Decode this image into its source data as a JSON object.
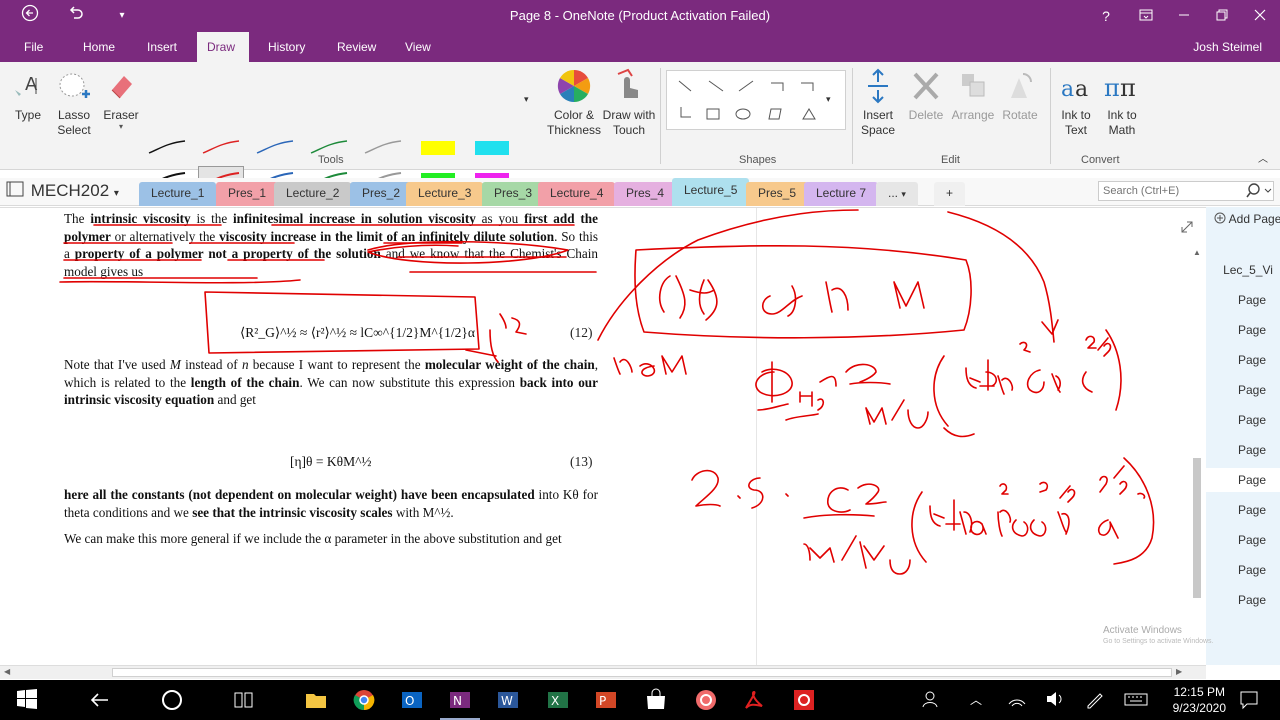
{
  "window": {
    "title": "Page 8 - OneNote (Product Activation Failed)",
    "help": "?",
    "user": "Josh Steimel"
  },
  "menu": {
    "tabs": [
      "File",
      "Home",
      "Insert",
      "Draw",
      "History",
      "Review",
      "View"
    ],
    "active": "Draw"
  },
  "ribbon": {
    "type": "Type",
    "lasso": "Lasso Select",
    "eraser": "Eraser",
    "color_thickness": "Color & Thickness",
    "draw_touch": "Draw with Touch",
    "insert_space": "Insert Space",
    "delete": "Delete",
    "arrange": "Arrange",
    "rotate": "Rotate",
    "ink_text": "Ink to Text",
    "ink_math": "Ink to Math",
    "groups": {
      "tools": "Tools",
      "shapes": "Shapes",
      "edit": "Edit",
      "convert": "Convert"
    }
  },
  "notebook": {
    "name": "MECH202"
  },
  "sections": [
    "Lecture_1",
    "Pres_1",
    "Lecture_2",
    "Pres_2",
    "Lecture_3",
    "Pres_3",
    "Lecture_4",
    "Pres_4",
    "Lecture_5",
    "Pres_5",
    "Lecture 7",
    "..."
  ],
  "active_section": "Lecture_5",
  "search": {
    "placeholder": "Search (Ctrl+E)"
  },
  "pages_panel": {
    "add_page": "Add Page",
    "items": [
      "Lec_5_Vi",
      "Page",
      "Page",
      "Page",
      "Page",
      "Page",
      "Page",
      "Page",
      "Page",
      "Page",
      "Page",
      "Page",
      "Page"
    ],
    "selected": 7
  },
  "document": {
    "para1_a": "The ",
    "para1_b": "intrinsic viscosity",
    "para1_c": " is the ",
    "para1_d": "infinitesimal increase in solution viscosity",
    "para1_e": " as you ",
    "para1_f": "first add the polymer",
    "para1_g": " or alternatively the ",
    "para1_h": "viscosity increase in the limit of an infinitely dilute solution",
    "para1_i": ". So this a ",
    "para1_j": "property of a polymer not a property of the solution",
    "para1_k": " and we know that the Chemist's Chain model gives us",
    "eq12": "⟨R²_G⟩^½ ≈ ⟨r²⟩^½ ≈ lC∞^{1/2}M^{1/2}α",
    "eq12_num": "(12)",
    "para2_a": "Note that I've used ",
    "para2_M": "M",
    "para2_b": " instead of ",
    "para2_n": "n",
    "para2_c": " because I want to represent the ",
    "para2_d": "molecular weight of the chain",
    "para2_e": ", which is related to the ",
    "para2_f": "length of the chain",
    "para2_g": ". We can now substitute this expression ",
    "para2_h": "back into our intrinsic viscosity equation",
    "para2_i": " and get",
    "eq13": "[η]θ = KθM^½",
    "eq13_num": "(13)",
    "para3_a": "here all the constants (not dependent on molecular weight) have been encapsulated",
    "para3_b": " into Kθ for theta conditions and we ",
    "para3_c": "see that the intrinsic viscosity scales",
    "para3_d": " with M^½.",
    "para4": "We can make this more general if we include the α parameter in the above substitution and get"
  },
  "watermark": {
    "line1": "Activate Windows",
    "line2": "Go to Settings to activate Windows."
  },
  "clock": {
    "time": "12:15 PM",
    "date": "9/23/2020"
  },
  "colors": {
    "accent": "#7b2a7e",
    "ink": "#e00000"
  }
}
